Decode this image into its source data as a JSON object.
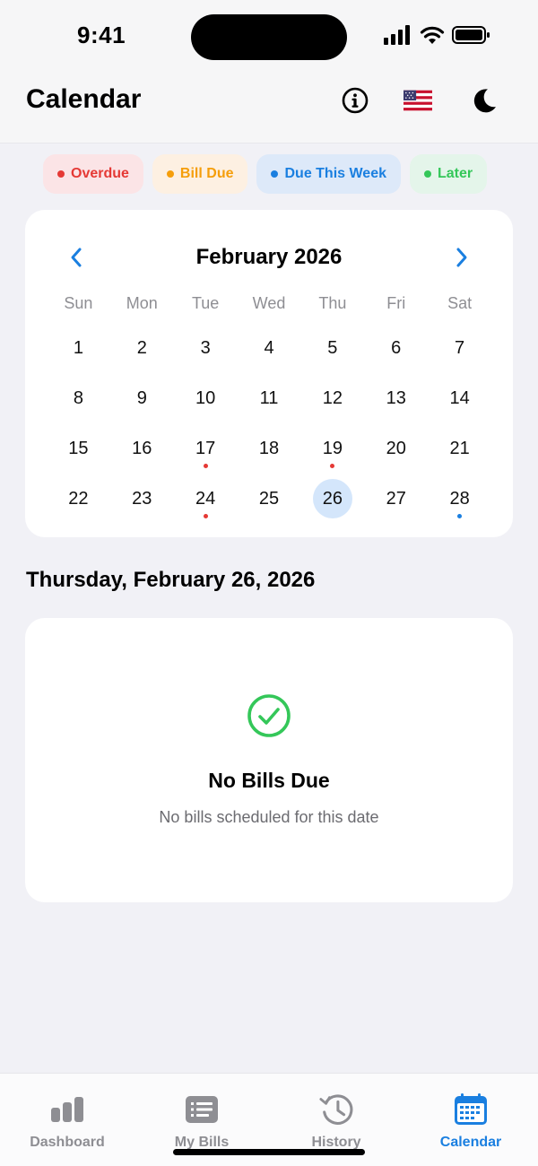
{
  "status_bar": {
    "time": "9:41"
  },
  "header": {
    "title": "Calendar",
    "info_icon": "info-icon",
    "flag_icon": "us-flag-icon",
    "theme_icon": "moon-icon"
  },
  "legend": [
    {
      "label": "Overdue",
      "color": "#e53935",
      "bg": "#fbe4e6"
    },
    {
      "label": "Bill Due",
      "color": "#f59e0b",
      "bg": "#fdf0e2"
    },
    {
      "label": "Due This Week",
      "color": "#1a7fe0",
      "bg": "#dde9f9"
    },
    {
      "label": "Later",
      "color": "#34c759",
      "bg": "#e4f5ea"
    }
  ],
  "calendar": {
    "month_title": "February 2026",
    "weekdays": [
      "Sun",
      "Mon",
      "Tue",
      "Wed",
      "Thu",
      "Fri",
      "Sat"
    ],
    "days": [
      "1",
      "2",
      "3",
      "4",
      "5",
      "6",
      "7",
      "8",
      "9",
      "10",
      "11",
      "12",
      "13",
      "14",
      "15",
      "16",
      "17",
      "18",
      "19",
      "20",
      "21",
      "22",
      "23",
      "24",
      "25",
      "26",
      "27",
      "28"
    ],
    "selected_day": "26",
    "markers": {
      "17": "#e53935",
      "19": "#e53935",
      "24": "#e53935",
      "28": "#1a7fe0"
    },
    "selected_bg": "#d4e6fb"
  },
  "selected_date_heading": "Thursday, February 26, 2026",
  "empty_state": {
    "icon": "check-circle-icon",
    "title": "No Bills Due",
    "subtitle": "No bills scheduled for this date",
    "icon_color": "#34c759"
  },
  "tabs": [
    {
      "label": "Dashboard",
      "icon": "bar-chart-icon",
      "active": false
    },
    {
      "label": "My Bills",
      "icon": "list-icon",
      "active": false
    },
    {
      "label": "History",
      "icon": "history-icon",
      "active": false
    },
    {
      "label": "Calendar",
      "icon": "calendar-icon",
      "active": true
    }
  ],
  "accent_color": "#1a7fe0"
}
